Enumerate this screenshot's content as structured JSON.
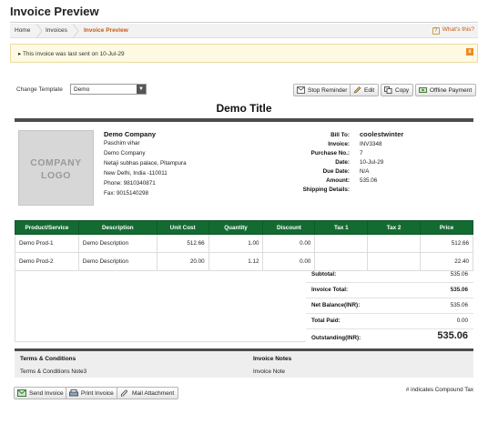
{
  "page": {
    "title": "Invoice Preview"
  },
  "breadcrumb": {
    "items": [
      "Home",
      "Invoices",
      "Invoice Preview"
    ],
    "help_label": "What's this?"
  },
  "notice": {
    "text": "This invoice was last sent on 10-Jul-29",
    "close_glyph": "x"
  },
  "toolbar": {
    "template_label": "Change Template",
    "template_value": "Demo",
    "stop_reminder": "Stop Reminder",
    "edit": "Edit",
    "copy": "Copy",
    "offline_payment": "Offline Payment"
  },
  "document": {
    "title": "Demo Title"
  },
  "logo": {
    "line1": "COMPANY",
    "line2": "LOGO"
  },
  "company": {
    "name": "Demo Company",
    "lines": [
      "Paschim vihar",
      "Demo Company",
      "Netaji subhas palace, Pitampura",
      "New Delhi, India -110011",
      "Phone: 9810340871",
      "Fax: 9015140298"
    ]
  },
  "billing": {
    "bill_to_label": "Bill To:",
    "bill_to_value": "coolestwinter",
    "rows": [
      {
        "label": "Invoice:",
        "value": "INV3348"
      },
      {
        "label": "Purchase No.:",
        "value": "7"
      },
      {
        "label": "Date:",
        "value": "10-Jul-29"
      },
      {
        "label": "Due Date:",
        "value": "N/A"
      },
      {
        "label": "Amount:",
        "value": "535.06"
      },
      {
        "label": "Shipping Details:",
        "value": ""
      }
    ]
  },
  "items_table": {
    "headers": [
      "Product/Service",
      "Description",
      "Unit Cost",
      "Quantity",
      "Discount",
      "Tax 1",
      "Tax 2",
      "Price"
    ],
    "rows": [
      [
        "Demo Prod-1",
        "Demo Description",
        "512.66",
        "1.00",
        "0.00",
        "",
        "",
        "512.66"
      ],
      [
        "Demo Prod-2",
        "Demo Description",
        "20.00",
        "1.12",
        "0.00",
        "",
        "",
        "22.40"
      ]
    ]
  },
  "totals": [
    {
      "label": "Subtotal:",
      "value": "535.06"
    },
    {
      "label": "Invoice Total:",
      "value": "535.06"
    },
    {
      "label": "Net Balance(INR):",
      "value": "535.06"
    },
    {
      "label": "Total Paid:",
      "value": "0.00"
    },
    {
      "label": "Outstanding(INR):",
      "value": "535.06"
    }
  ],
  "terms": {
    "terms_heading": "Terms & Conditions",
    "terms_text": "Terms & Conditions Note3",
    "notes_heading": "Invoice Notes",
    "notes_text": "Invoice Note"
  },
  "footer": {
    "send_invoice": "Send Invoice",
    "print_invoice": "Print Invoice",
    "mail_attachment": "Mail Attachment",
    "compound_note": "# indicates Compound Tax"
  },
  "colors": {
    "table_header": "#146b32",
    "accent": "#c75a14",
    "notice_bg": "#fdf9e3"
  }
}
